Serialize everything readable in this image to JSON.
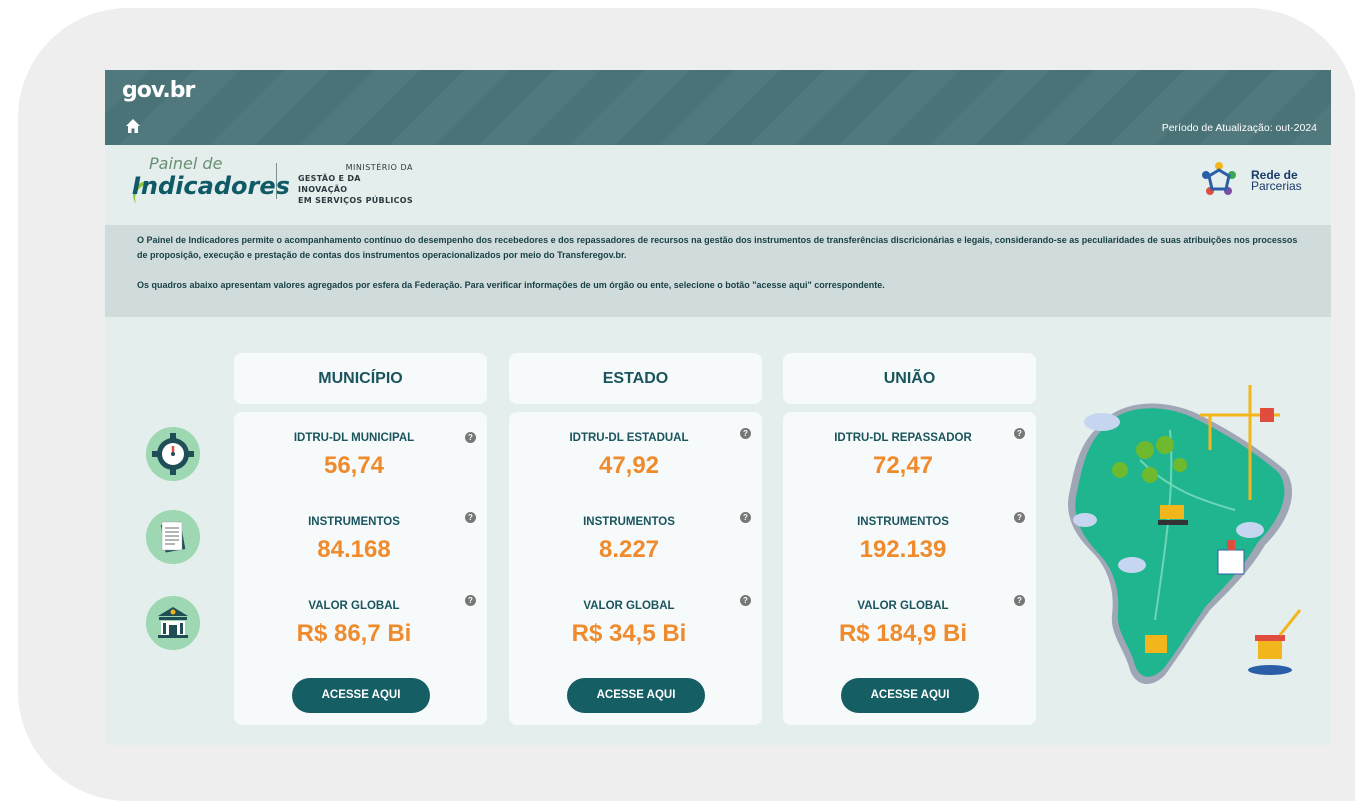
{
  "header": {
    "logo": "gov.br",
    "period_label": "Período de Atualização: out-2024"
  },
  "brand": {
    "painel_small": "Painel de",
    "painel_big": "Indicadores",
    "ministerio_line1": "MINISTÉRIO DA",
    "ministerio_line2": "GESTÃO E DA INOVAÇÃO",
    "ministerio_line3": "EM SERVIÇOS PÚBLICOS",
    "rede_line1": "Rede de",
    "rede_line2": "Parcerias"
  },
  "intro": {
    "paragraph1": "O Painel de Indicadores permite o acompanhamento contínuo do desempenho dos recebedores e dos repassadores de recursos na gestão dos instrumentos de transferências discricionárias e legais, considerando-se as peculiaridades de suas atribuições nos processos de proposição, execução e prestação de contas dos instrumentos operacionalizados por meio do Transferegov.br.",
    "paragraph2": "Os quadros abaixo apresentam valores agregados por esfera da Federação. Para verificar informações de um órgão ou ente, selecione o botão \"acesse aqui\" correspondente."
  },
  "cards": [
    {
      "title": "MUNICÍPIO",
      "idx_label": "IDTRU-DL MUNICIPAL",
      "idx_value": "56,74",
      "inst_label": "INSTRUMENTOS",
      "inst_value": "84.168",
      "valor_label": "VALOR GLOBAL",
      "valor_value": "R$ 86,7 Bi",
      "button": "ACESSE AQUI"
    },
    {
      "title": "ESTADO",
      "idx_label": "IDTRU-DL ESTADUAL",
      "idx_value": "47,92",
      "inst_label": "INSTRUMENTOS",
      "inst_value": "8.227",
      "valor_label": "VALOR GLOBAL",
      "valor_value": "R$ 34,5 Bi",
      "button": "ACESSE AQUI"
    },
    {
      "title": "UNIÃO",
      "idx_label": "IDTRU-DL REPASSADOR",
      "idx_value": "72,47",
      "inst_label": "INSTRUMENTOS",
      "inst_value": "192.139",
      "valor_label": "VALOR GLOBAL",
      "valor_value": "R$ 184,9 Bi",
      "button": "ACESSE AQUI"
    }
  ],
  "help_glyph": "?",
  "side_icons": [
    "gauge-gear-icon",
    "documents-icon",
    "bank-icon"
  ],
  "colors": {
    "header_bg": "#4a7378",
    "accent_teal": "#155e64",
    "value_orange": "#ef8b2c",
    "title_teal": "#1a545d"
  }
}
